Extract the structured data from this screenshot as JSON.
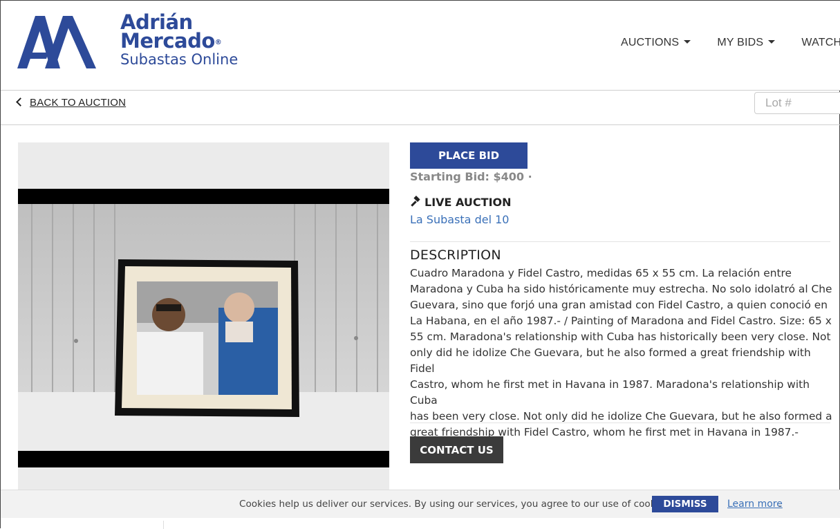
{
  "brand": {
    "line1": "Adrián",
    "line2": "Mercado",
    "line3": "Subastas Online",
    "registered": "®",
    "color": "#2d4a99"
  },
  "nav": {
    "items": [
      {
        "label": "AUCTIONS",
        "icon": "caret-down-icon"
      },
      {
        "label": "MY BIDS",
        "icon": "caret-down-icon"
      },
      {
        "label": "WATCHED",
        "icon": ""
      }
    ]
  },
  "subbar": {
    "back_label": "BACK TO AUCTION",
    "lot_placeholder": "Lot #"
  },
  "lot": {
    "image_alt": "Framed photo of Maradona and Fidel Castro",
    "place_bid_label": "PLACE BID",
    "starting_bid": "Starting Bid: $400 ·",
    "live_auction_label": "LIVE AUCTION",
    "auction_name": "La Subasta del 10",
    "description_title": "DESCRIPTION",
    "description_lines": [
      "Cuadro Maradona y Fidel Castro, medidas 65 x 55 cm. La relación entre",
      "Maradona y Cuba ha sido históricamente muy estrecha. No solo idolatró al Che",
      "Guevara, sino que forjó una gran amistad con Fidel Castro, a quien conoció en",
      "La Habana, en el año 1987.- / Painting of Maradona and Fidel Castro. Size: 65 x",
      "55 cm. Maradona's relationship with Cuba has historically been very close. Not",
      "only did he idolize Che Guevara, but he also formed a great friendship with Fidel",
      "Castro, whom he first met in Havana in 1987. Maradona's relationship with Cuba",
      "has been very close. Not only did he idolize Che Guevara, but he also formed a",
      "great friendship with Fidel Castro, whom he first met in Havana in 1987.-"
    ],
    "contact_label": "CONTACT US"
  },
  "cookie": {
    "text": "Cookies help us deliver our services. By using our services, you agree to our use of cookies.",
    "dismiss_label": "DISMISS",
    "learn_more_label": "Learn more",
    "learn_more_suffix": "."
  },
  "colors": {
    "primary": "#2d4a99",
    "link": "#3a70b8",
    "dark_button": "#3b3b3b"
  }
}
